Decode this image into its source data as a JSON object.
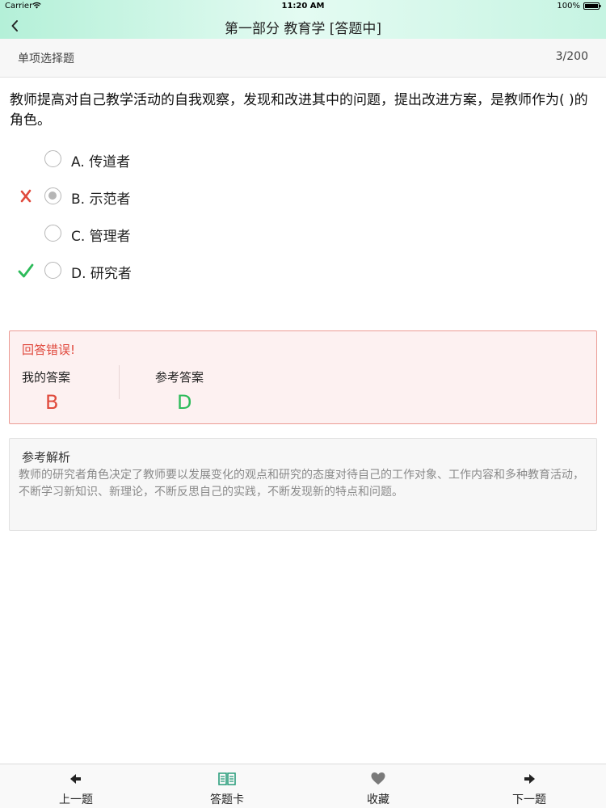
{
  "status_bar": {
    "carrier": "Carrier",
    "time": "11:20 AM",
    "battery": "100%"
  },
  "nav": {
    "title": "第一部分 教育学 [答题中]"
  },
  "sub_header": {
    "type": "单项选择题",
    "progress": "3/200"
  },
  "question": {
    "text": "教师提高对自己教学活动的自我观察，发现和改进其中的问题，提出改进方案，是教师作为(    )的角色。",
    "options": [
      {
        "label": "A. 传道者",
        "selected": false,
        "mark": ""
      },
      {
        "label": "B. 示范者",
        "selected": true,
        "mark": "wrong"
      },
      {
        "label": "C. 管理者",
        "selected": false,
        "mark": ""
      },
      {
        "label": "D. 研究者",
        "selected": false,
        "mark": "correct"
      }
    ]
  },
  "result": {
    "title": "回答错误!",
    "my_answer_label": "我的答案",
    "my_answer": "B",
    "ref_answer_label": "参考答案",
    "ref_answer": "D"
  },
  "analysis": {
    "title": "参考解析",
    "text": "教师的研究者角色决定了教师要以发展变化的观点和研究的态度对待自己的工作对象、工作内容和多种教育活动，不断学习新知识、新理论，不断反思自己的实践，不断发现新的特点和问题。"
  },
  "bottom_bar": {
    "tabs": [
      {
        "label": "上一题",
        "icon": "arrow-left-icon"
      },
      {
        "label": "答题卡",
        "icon": "book-icon"
      },
      {
        "label": "收藏",
        "icon": "heart-icon"
      },
      {
        "label": "下一题",
        "icon": "arrow-right-icon"
      }
    ]
  },
  "colors": {
    "header_gradient": "#b4f0d8",
    "wrong": "#e04a3c",
    "correct": "#2dbb5a",
    "tab_icon_active": "#2a9d7c"
  }
}
